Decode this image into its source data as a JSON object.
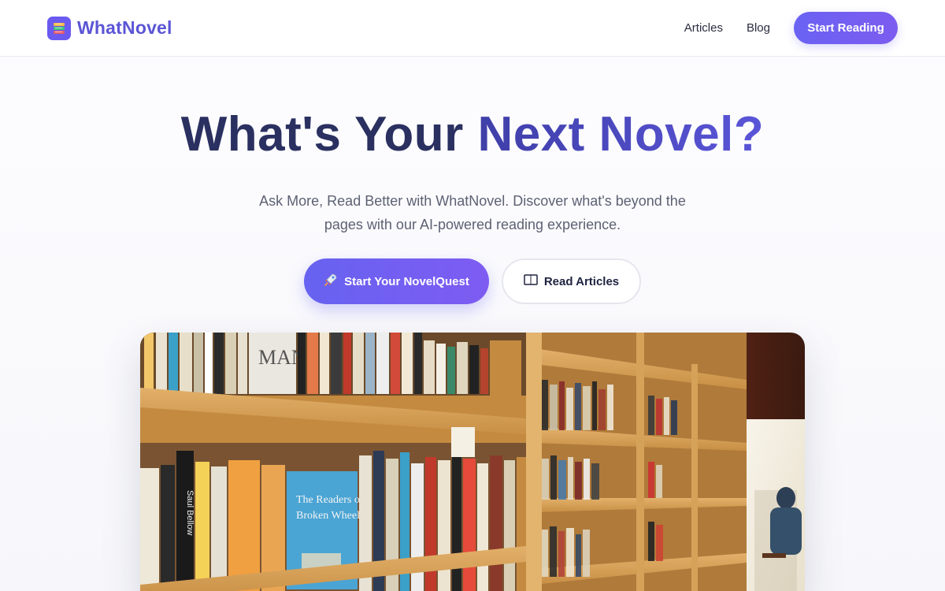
{
  "header": {
    "brand": "WhatNovel",
    "nav": [
      "Articles",
      "Blog"
    ],
    "cta_label": "Start Reading"
  },
  "hero": {
    "title_dark": "What's Your",
    "title_accent": "Next Novel?",
    "subtitle_line1": "Ask More, Read Better with WhatNovel. Discover what's beyond the",
    "subtitle_line2": "pages with our AI-powered reading experience.",
    "primary_button": "Start Your NovelQuest",
    "secondary_button": "Read Articles"
  },
  "colors": {
    "brand": "#5b55d6",
    "accent": "#6a62f2",
    "title_dark": "#2a3060"
  },
  "image": {
    "subject": "bookstore shelves"
  }
}
